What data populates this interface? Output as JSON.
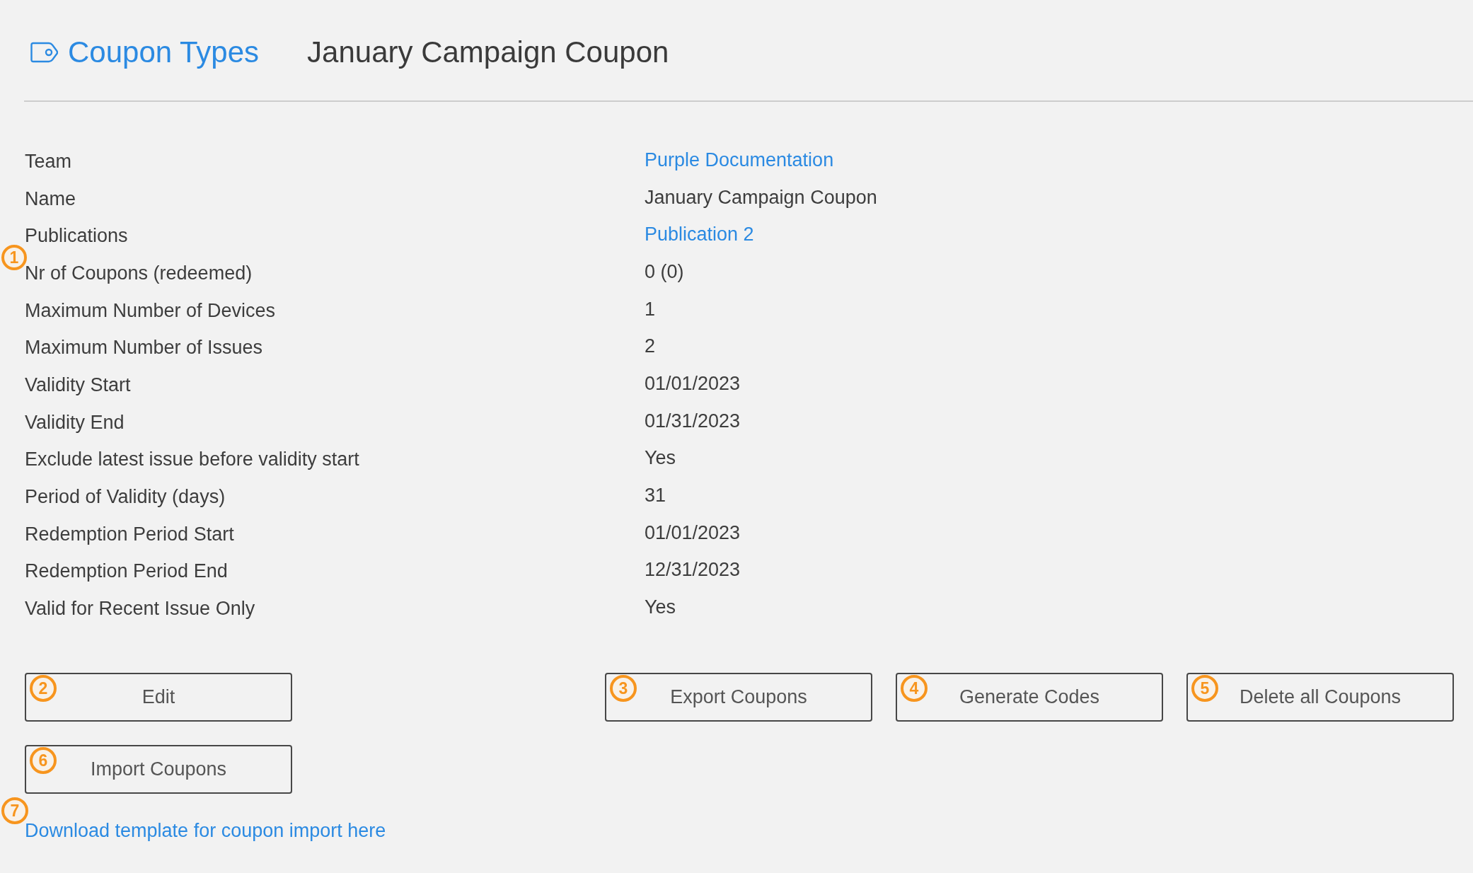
{
  "header": {
    "breadcrumb": "Coupon Types",
    "title": "January Campaign Coupon"
  },
  "details": [
    {
      "label": "Team",
      "value": "Purple Documentation",
      "kind": "link"
    },
    {
      "label": "Name",
      "value": "January Campaign Coupon",
      "kind": "text"
    },
    {
      "label": "Publications",
      "value": "Publication 2",
      "kind": "link"
    },
    {
      "label": "Nr of Coupons (redeemed)",
      "value": "0 (0)",
      "kind": "text",
      "marker": "1"
    },
    {
      "label": "Maximum Number of Devices",
      "value": "1",
      "kind": "text"
    },
    {
      "label": "Maximum Number of Issues",
      "value": "2",
      "kind": "text"
    },
    {
      "label": "Validity Start",
      "value": "01/01/2023",
      "kind": "text"
    },
    {
      "label": "Validity End",
      "value": "01/31/2023",
      "kind": "text"
    },
    {
      "label": "Exclude latest issue before validity start",
      "value": "Yes",
      "kind": "text"
    },
    {
      "label": "Period of Validity (days)",
      "value": "31",
      "kind": "text"
    },
    {
      "label": "Redemption Period Start",
      "value": "01/01/2023",
      "kind": "text"
    },
    {
      "label": "Redemption Period End",
      "value": "12/31/2023",
      "kind": "text"
    },
    {
      "label": "Valid for Recent Issue Only",
      "value": "Yes",
      "kind": "text"
    }
  ],
  "actions": {
    "left": [
      {
        "label": "Edit",
        "marker": "2"
      },
      {
        "label": "Import Coupons",
        "marker": "6"
      }
    ],
    "right": [
      {
        "label": "Export Coupons",
        "marker": "3"
      },
      {
        "label": "Generate Codes",
        "marker": "4"
      },
      {
        "label": "Delete all Coupons",
        "marker": "5"
      }
    ]
  },
  "download_link": {
    "text": "Download template for coupon import here",
    "marker": "7"
  }
}
